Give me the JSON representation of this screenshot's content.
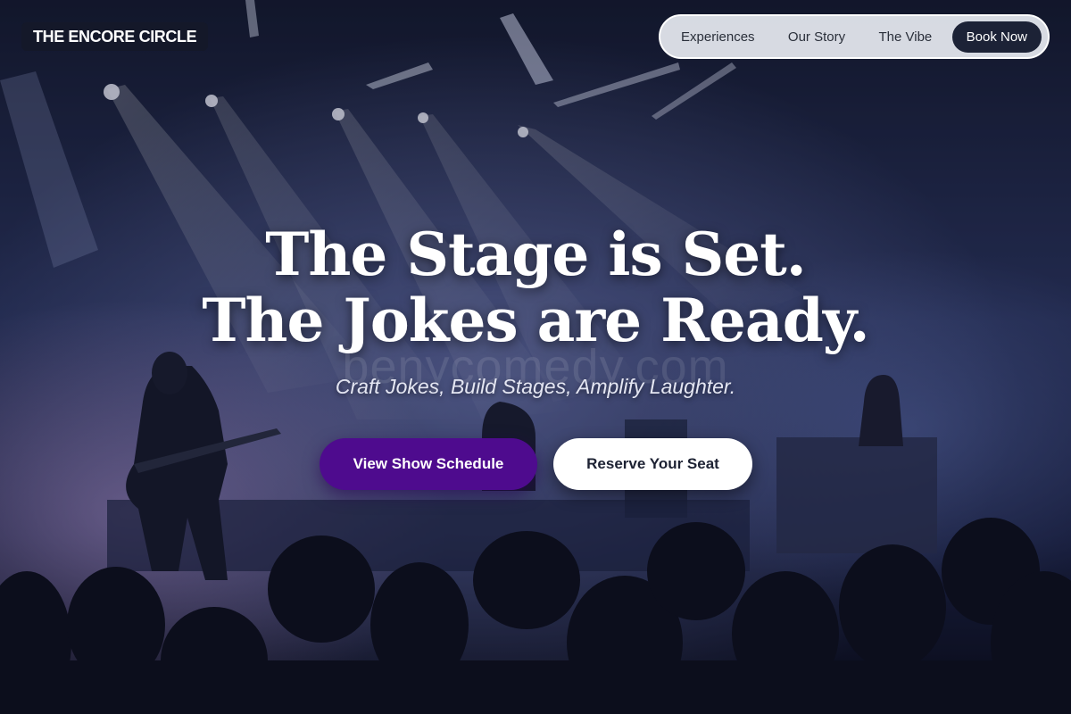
{
  "brand": {
    "name": "THE ENCORE CIRCLE"
  },
  "nav": {
    "items": [
      {
        "label": "Experiences"
      },
      {
        "label": "Our Story"
      },
      {
        "label": "The Vibe"
      }
    ],
    "cta_label": "Book Now"
  },
  "hero": {
    "headline_line1": "The Stage is Set.",
    "headline_line2": "The Jokes are Ready.",
    "watermark": "benycomedy.com",
    "tagline": "Craft Jokes, Build Stages, Amplify Laughter.",
    "primary_button": "View Show Schedule",
    "secondary_button": "Reserve Your Seat"
  },
  "colors": {
    "primary_button": "#4e0b8e",
    "nav_cta": "#1c2236",
    "background": "#0b0f22"
  }
}
